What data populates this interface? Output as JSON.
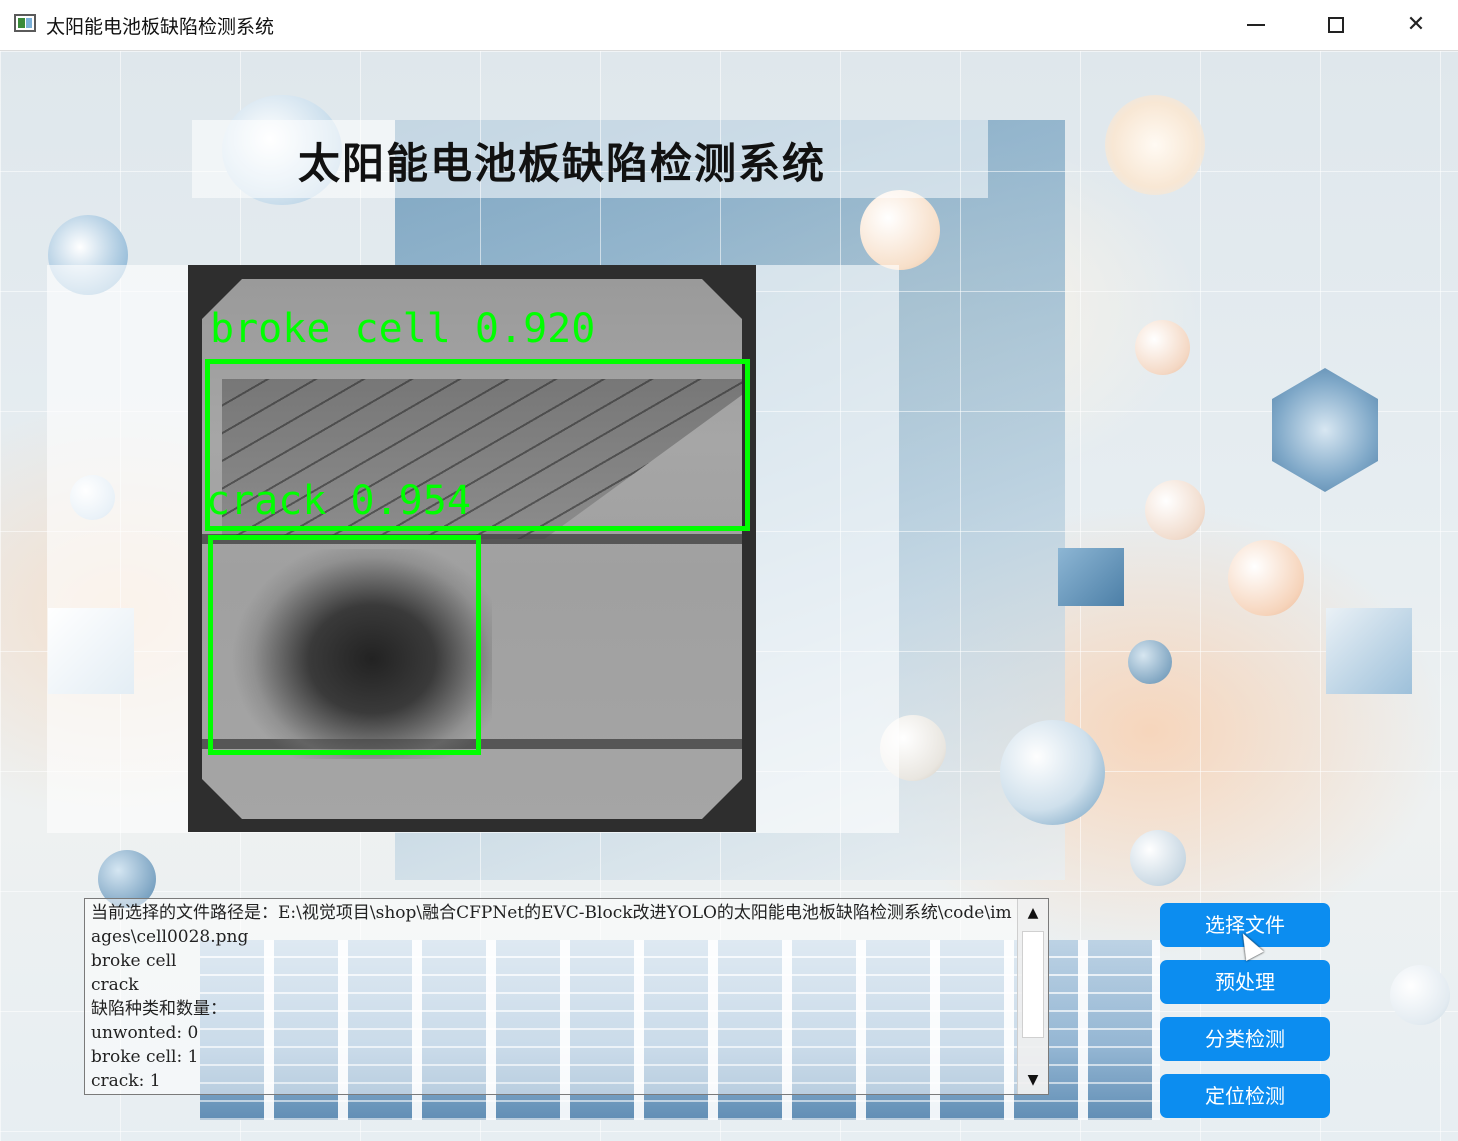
{
  "window": {
    "title": "太阳能电池板缺陷检测系统",
    "controls": {
      "minimize": "minimize-icon",
      "maximize": "maximize-icon",
      "close": "close-icon"
    }
  },
  "header": {
    "title": "太阳能电池板缺陷检测系统"
  },
  "detections": [
    {
      "label": "broke cell 0.920"
    },
    {
      "label": "crack 0.954"
    }
  ],
  "output": {
    "text": "当前选择的文件路径是：E:\\视觉项目\\shop\\融合CFPNet的EVC-Block改进YOLO的太阳能电池板缺陷检测系统\\code\\images\\cell0028.png\nbroke cell\ncrack\n缺陷种类和数量：\nunwonted: 0\nbroke cell: 1\ncrack: 1"
  },
  "scrollbar": {
    "up": "▲",
    "down": "▼"
  },
  "buttons": {
    "select_file": "选择文件",
    "preprocess": "预处理",
    "classify": "分类检测",
    "locate": "定位检测"
  },
  "colors": {
    "accent_button": "#0c8df0",
    "detection_box": "#00ff00"
  }
}
